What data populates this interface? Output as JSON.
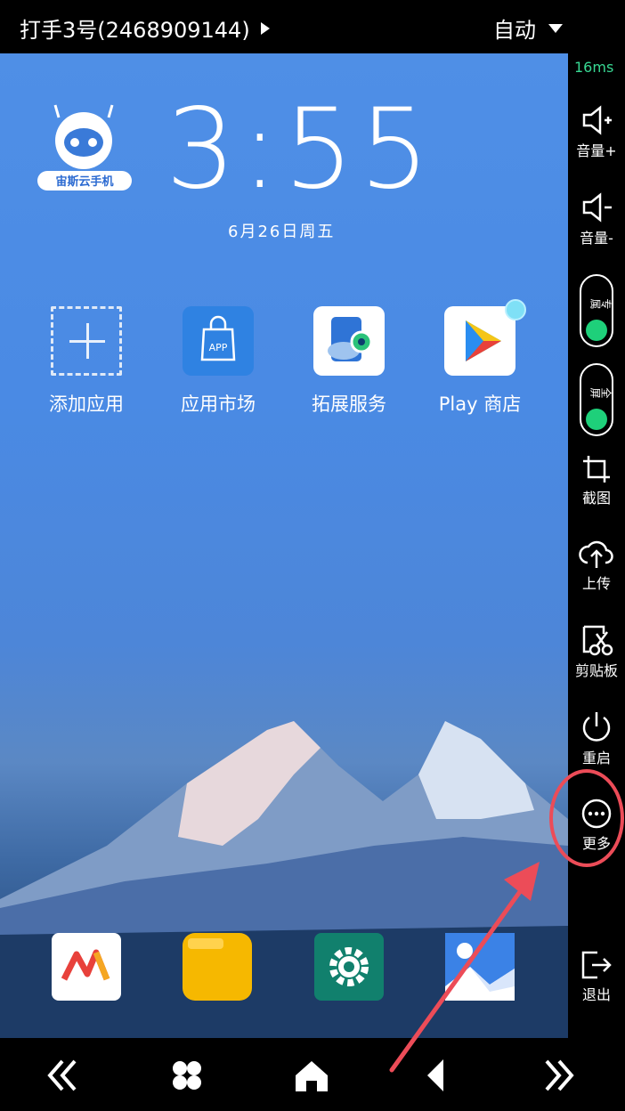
{
  "topbar": {
    "device_title": "打手3号(2468909144)",
    "mode": "自动"
  },
  "home": {
    "clock": "3:55",
    "date": "6月26日周五",
    "logo_text": "宙斯云手机",
    "apps": [
      {
        "label": "添加应用",
        "icon": "add-app-icon"
      },
      {
        "label": "应用市场",
        "icon": "app-market-icon",
        "tile_text": "APP"
      },
      {
        "label": "拓展服务",
        "icon": "extension-service-icon"
      },
      {
        "label": "Play 商店",
        "icon": "play-store-icon"
      }
    ],
    "dock": [
      {
        "icon": "yunlian-app-icon"
      },
      {
        "icon": "files-icon"
      },
      {
        "icon": "settings-icon"
      },
      {
        "icon": "gallery-icon"
      }
    ]
  },
  "sidebar": {
    "latency": "16ms",
    "volume_up": "音量+",
    "volume_down": "音量-",
    "toggle1": "专属",
    "toggle2": "全屏",
    "screenshot": "截图",
    "upload": "上传",
    "clipboard": "剪贴板",
    "restart": "重启",
    "more": "更多",
    "exit": "退出"
  },
  "colors": {
    "accent_green": "#1ed07a",
    "highlight_red": "#ec4c58",
    "latency_green": "#38d893"
  }
}
